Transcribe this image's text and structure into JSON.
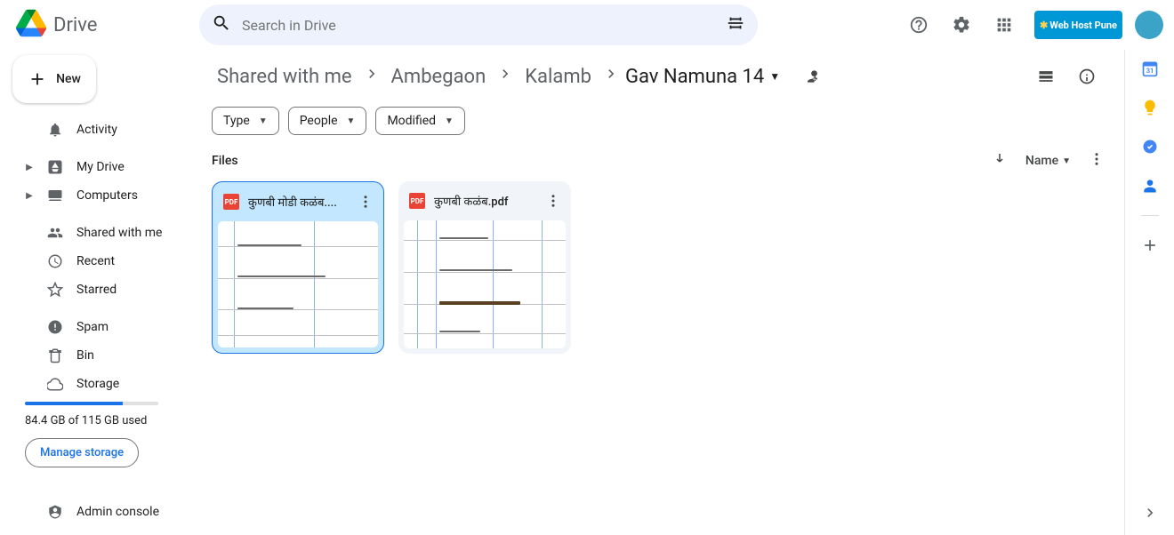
{
  "header": {
    "product": "Drive",
    "search_placeholder": "Search in Drive",
    "chip_text": "Web Host Pune"
  },
  "sidebar": {
    "new_label": "New",
    "items": [
      {
        "label": "Activity"
      },
      {
        "label": "My Drive"
      },
      {
        "label": "Computers"
      },
      {
        "label": "Shared with me"
      },
      {
        "label": "Recent"
      },
      {
        "label": "Starred"
      },
      {
        "label": "Spam"
      },
      {
        "label": "Bin"
      },
      {
        "label": "Storage"
      }
    ],
    "storage_text": "84.4 GB of 115 GB used",
    "storage_pct": 73,
    "manage_label": "Manage storage",
    "admin_label": "Admin console"
  },
  "breadcrumbs": {
    "parts": [
      "Shared with me",
      "Ambegaon",
      "Kalamb"
    ],
    "current": "Gav Namuna 14"
  },
  "filters": {
    "type": "Type",
    "people": "People",
    "modified": "Modified"
  },
  "section_title": "Files",
  "sort": {
    "label": "Name"
  },
  "files": [
    {
      "name": "कुणबी मोडी कळंब....",
      "type_badge": "PDF"
    },
    {
      "name": "कुणबी कळंब.pdf",
      "type_badge": "PDF"
    }
  ]
}
